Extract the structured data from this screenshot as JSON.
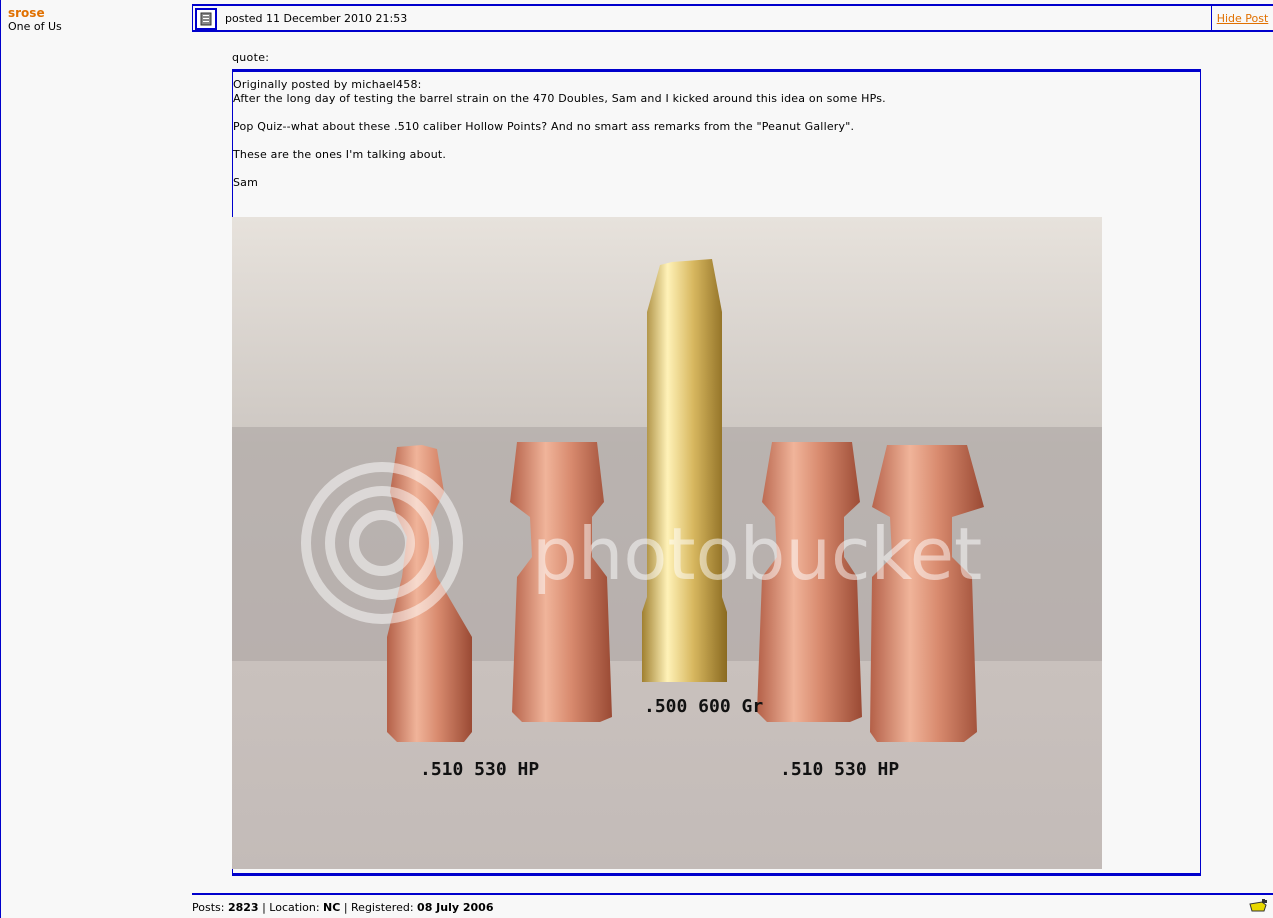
{
  "author": {
    "name": "srose",
    "title": "One of Us"
  },
  "post": {
    "posted_text": "posted 11 December 2010 21:53",
    "hide_label": "Hide Post"
  },
  "quote": {
    "label": "quote:",
    "header": "Originally posted by michael458:",
    "lines": [
      "After the long day of testing the barrel strain on the 470 Doubles, Sam and I kicked around this idea on some HPs.",
      "Pop Quiz--what about these .510 caliber Hollow Points? And no smart ass remarks from the \"Peanut Gallery\".",
      "These are the ones I'm talking about.",
      "Sam"
    ]
  },
  "photo": {
    "watermark": "photobucket",
    "labels": [
      ".510 530 HP",
      ".500 600 Gr",
      ".510 530 HP"
    ]
  },
  "footer": {
    "posts_label": "Posts:",
    "posts_value": "2823",
    "location_label": "Location:",
    "location_value": "NC",
    "registered_label": "Registered:",
    "registered_value": "08 July 2006",
    "sep": "|"
  },
  "colors": {
    "border": "#0000cc",
    "accent": "#e07000"
  },
  "icons": {
    "post": "post-icon",
    "footer": "profile-icon"
  }
}
